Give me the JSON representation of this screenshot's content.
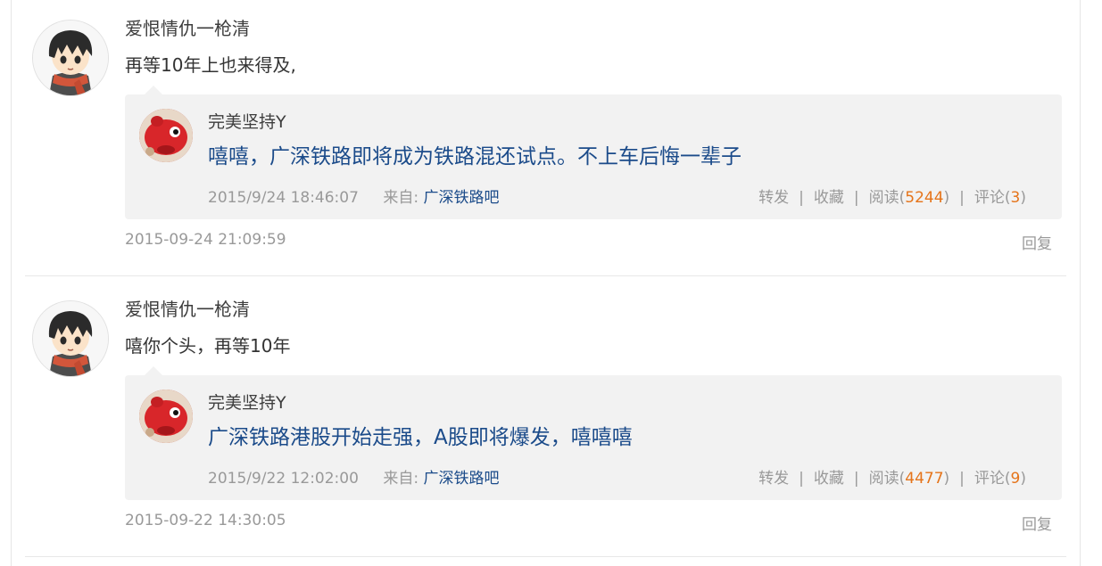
{
  "replies": [
    {
      "author": "爱恨情仇一枪清",
      "text": "再等10年上也来得及,",
      "time": "2015-09-24 21:09:59",
      "reply_label": "回复",
      "quote": {
        "author": "完美坚持Y",
        "text": "嘻嘻，广深铁路即将成为铁路混还试点。不上车后悔一辈子",
        "time": "2015/9/24 18:46:07",
        "source_label": "来自:",
        "source": "广深铁路吧",
        "repost": "转发",
        "favorite": "收藏",
        "read_label": "阅读",
        "read_count": "5244",
        "comment_label": "评论",
        "comment_count": "3"
      }
    },
    {
      "author": "爱恨情仇一枪清",
      "text": "嘻你个头，再等10年",
      "time": "2015-09-22 14:30:05",
      "reply_label": "回复",
      "quote": {
        "author": "完美坚持Y",
        "text": "广深铁路港股开始走强，A股即将爆发，嘻嘻嘻",
        "time": "2015/9/22 12:02:00",
        "source_label": "来自:",
        "source": "广深铁路吧",
        "repost": "转发",
        "favorite": "收藏",
        "read_label": "阅读",
        "read_count": "4477",
        "comment_label": "评论",
        "comment_count": "9"
      }
    }
  ],
  "colors": {
    "link": "#1b4b8a",
    "count": "#e5741a",
    "meta": "#999999",
    "quote_bg": "#f2f2f2"
  }
}
